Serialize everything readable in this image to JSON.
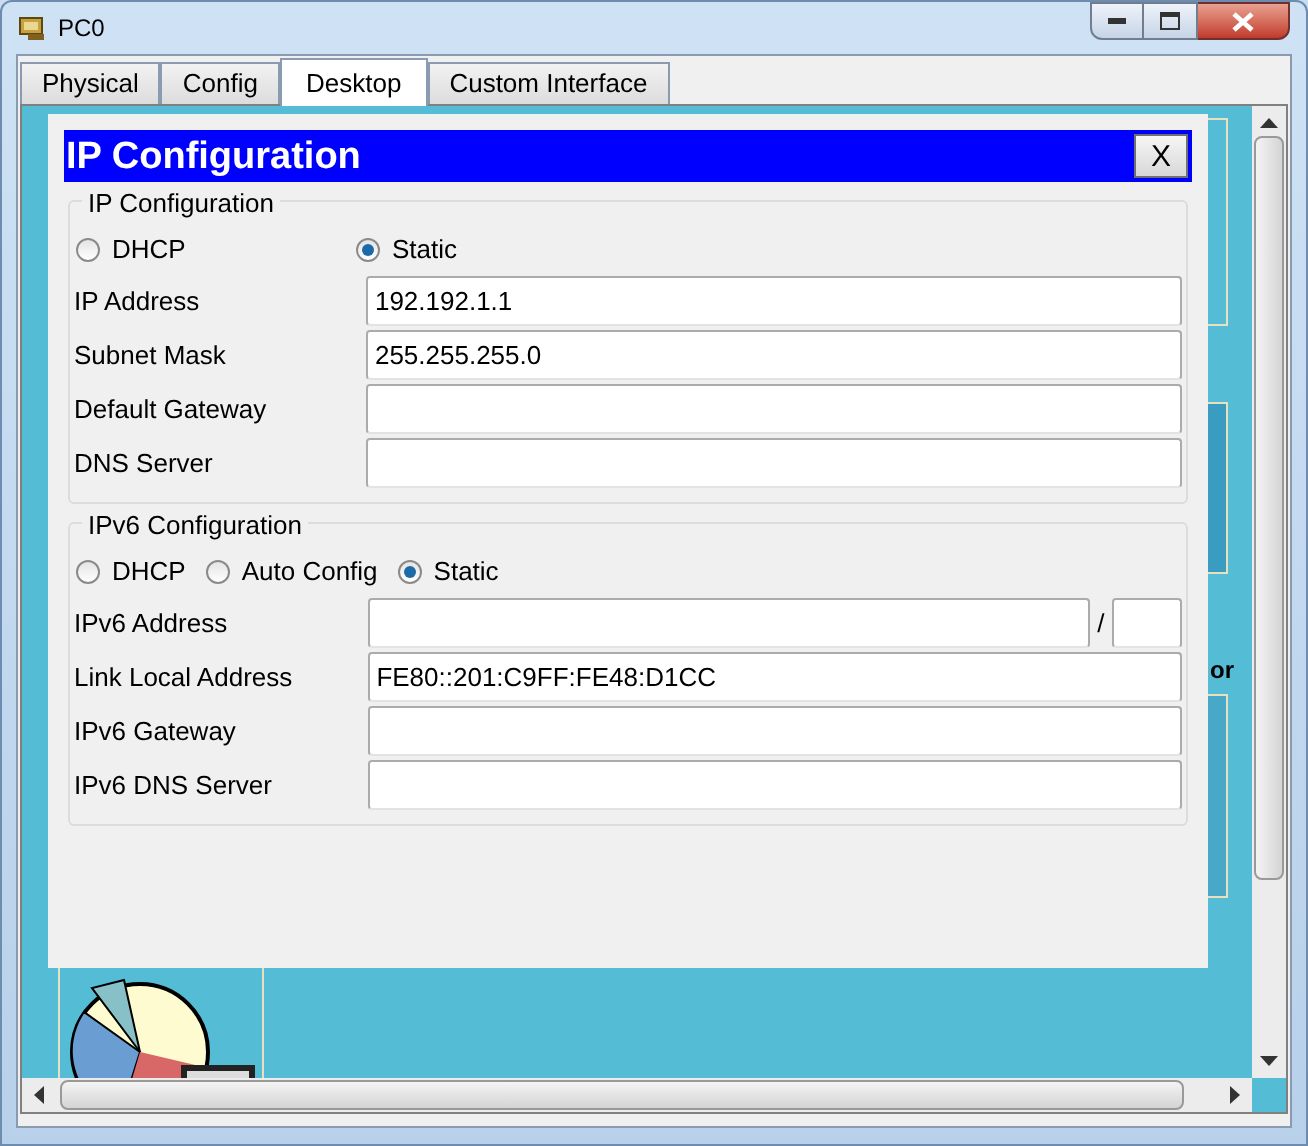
{
  "window": {
    "title": "PC0"
  },
  "tabs": [
    {
      "label": "Physical",
      "selected": false
    },
    {
      "label": "Config",
      "selected": false
    },
    {
      "label": "Desktop",
      "selected": true
    },
    {
      "label": "Custom Interface",
      "selected": false
    }
  ],
  "desktop": {
    "fragments": [
      "or"
    ]
  },
  "dialog": {
    "title": "IP Configuration",
    "close": "X",
    "ipv4": {
      "legend": "IP Configuration",
      "modes": [
        {
          "label": "DHCP",
          "selected": false
        },
        {
          "label": "Static",
          "selected": true
        }
      ],
      "fields": [
        {
          "kind": "text",
          "label": "IP Address",
          "value": "192.192.1.1"
        },
        {
          "kind": "text",
          "label": "Subnet Mask",
          "value": "255.255.255.0"
        },
        {
          "kind": "text",
          "label": "Default Gateway"
        },
        {
          "kind": "text",
          "label": "DNS Server"
        }
      ]
    },
    "ipv6": {
      "legend": "IPv6 Configuration",
      "modes": [
        {
          "label": "DHCP",
          "selected": false
        },
        {
          "label": "Auto Config",
          "selected": false
        },
        {
          "label": "Static",
          "selected": true
        }
      ],
      "fields": [
        {
          "kind": "prefixed",
          "label": "IPv6 Address",
          "separator": "/"
        },
        {
          "kind": "text",
          "label": "Link Local Address",
          "value": "FE80::201:C9FF:FE48:D1CC"
        },
        {
          "kind": "text",
          "label": "IPv6 Gateway"
        },
        {
          "kind": "text",
          "label": "IPv6 DNS Server"
        }
      ]
    }
  }
}
